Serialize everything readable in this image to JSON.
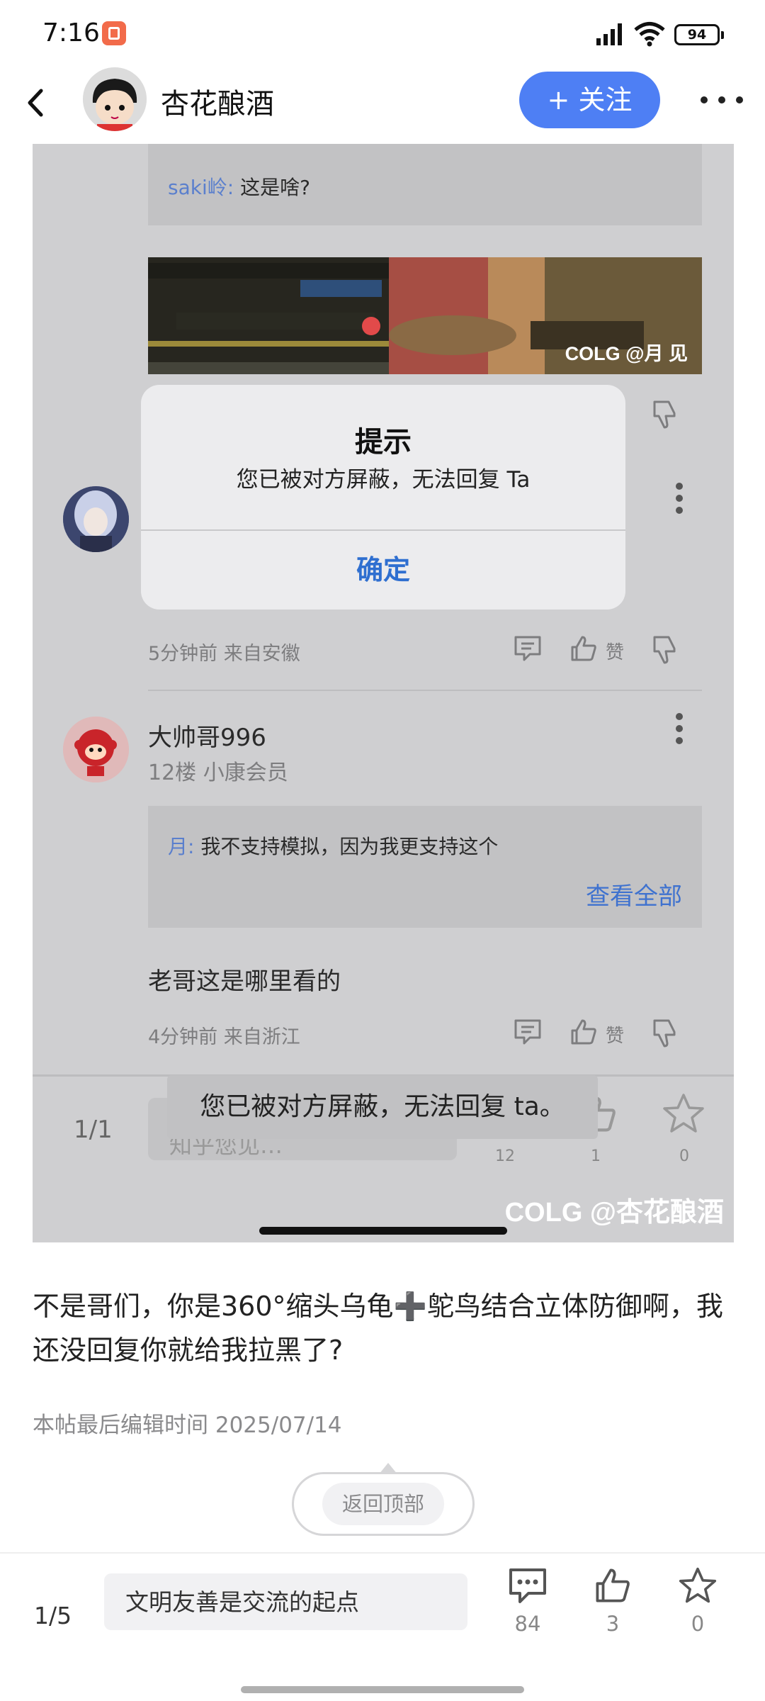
{
  "status_bar": {
    "time": "7:16",
    "battery": "94"
  },
  "header": {
    "username": "杏花酿酒",
    "follow_label": "+ 关注"
  },
  "screenshot": {
    "quote_1": {
      "author": "saki岭:",
      "text": "这是啥?"
    },
    "embedded_image_watermark": "COLG @月 见",
    "dialog": {
      "title": "提示",
      "message": "您已被对方屏蔽，无法回复 Ta",
      "confirm_label": "确定"
    },
    "comment_1": {
      "meta": "5分钟前 来自安徽",
      "like_label": "赞"
    },
    "comment_2": {
      "username": "大帅哥996",
      "floor_info": "12楼 小康会员",
      "quote": {
        "author": "月:",
        "text": "我不支持模拟，因为我更支持这个"
      },
      "view_all": "查看全部",
      "body": "老哥这是哪里看的",
      "meta": "4分钟前 来自浙江",
      "like_label": "赞"
    },
    "toast": "您已被对方屏蔽，无法回复 ta。",
    "inner_bottom": {
      "page": "1/1",
      "input_placeholder": "知乎您见…",
      "comment_count": "12",
      "like_count": "1",
      "star_count": "0"
    },
    "watermark": "COLG @杏花酿酒"
  },
  "post": {
    "text": "不是哥们，你是360°缩头乌龟➕鸵鸟结合立体防御啊，我还没回复你就给我拉黑了?",
    "edit_time": "本帖最后编辑时间 2025/07/14",
    "back_to_top": "返回顶部"
  },
  "bottom_bar": {
    "page": "1/5",
    "reply_placeholder": "文明友善是交流的起点",
    "comment_count": "84",
    "like_count": "3",
    "star_count": "0"
  },
  "colors": {
    "accent": "#4e7ff4",
    "dialog_button": "#2f6fd0",
    "quote_author": "#5a7fcd"
  }
}
